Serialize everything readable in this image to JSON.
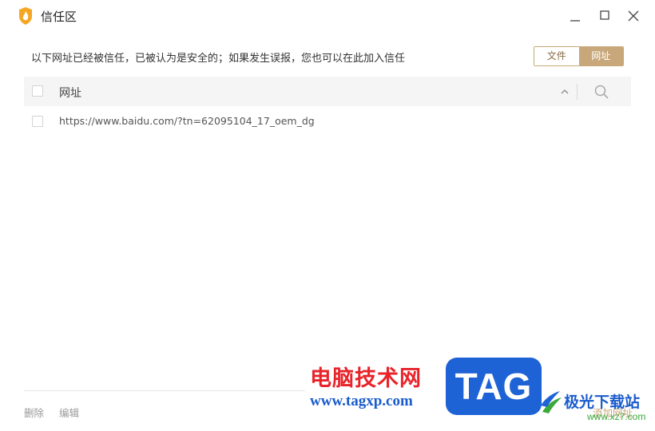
{
  "window": {
    "title": "信任区",
    "icon": "shield-flame-icon",
    "controls": [
      "minimize-icon",
      "maximize-icon",
      "close-icon"
    ]
  },
  "notice": "以下网址已经被信任，已被认为是安全的；如果发生误报，您也可以在此加入信任",
  "tabs": {
    "file": "文件",
    "url": "网址",
    "active": "网址"
  },
  "table": {
    "header": "网址",
    "rows": [
      {
        "url": "https://www.baidu.com/?tn=62095104_17_oem_dg",
        "checked": false
      }
    ]
  },
  "footer": {
    "delete": "删除",
    "edit": "编辑",
    "add": "添加网址"
  },
  "watermark": {
    "cn": "电脑技术网",
    "url": "www.tagxp.com",
    "logo": "TAG",
    "cn2": "极光下载站",
    "url2": "www.xz7.com"
  },
  "colors": {
    "accent": "#c8a77a",
    "watermark_red": "#e8232a",
    "watermark_blue": "#1e63d6"
  }
}
